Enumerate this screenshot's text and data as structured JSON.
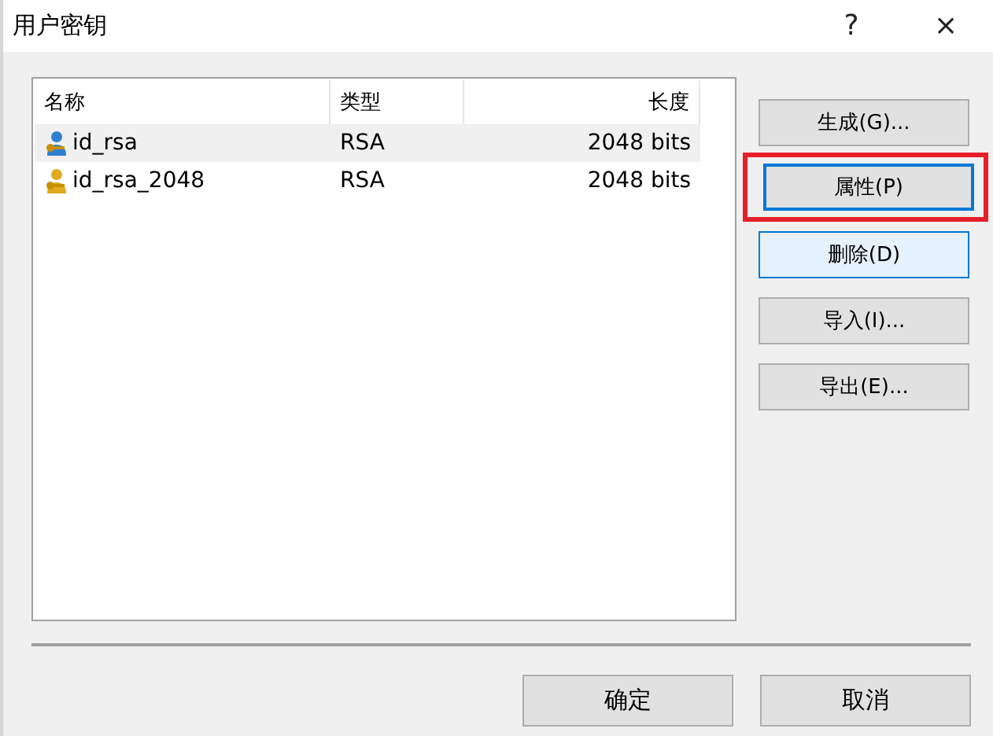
{
  "window": {
    "title": "用户密钥",
    "help": "?",
    "close": "×"
  },
  "table": {
    "columns": [
      "名称",
      "类型",
      "长度"
    ],
    "rows": [
      {
        "name": "id_rsa",
        "type": "RSA",
        "length": "2048 bits",
        "selected": true,
        "color": "#2f7fd0"
      },
      {
        "name": "id_rsa_2048",
        "type": "RSA",
        "length": "2048 bits",
        "selected": false,
        "color": "#e0a820"
      }
    ]
  },
  "side_buttons": [
    {
      "label": "生成(G)...",
      "focused": false,
      "hovered": false,
      "annotated": false
    },
    {
      "label": "属性(P)",
      "focused": true,
      "hovered": false,
      "annotated": true
    },
    {
      "label": "删除(D)",
      "focused": false,
      "hovered": true,
      "annotated": false
    },
    {
      "label": "导入(I)...",
      "focused": false,
      "hovered": false,
      "annotated": false
    },
    {
      "label": "导出(E)...",
      "focused": false,
      "hovered": false,
      "annotated": false
    }
  ],
  "bottom_buttons": [
    {
      "label": "确定"
    },
    {
      "label": "取消"
    }
  ]
}
